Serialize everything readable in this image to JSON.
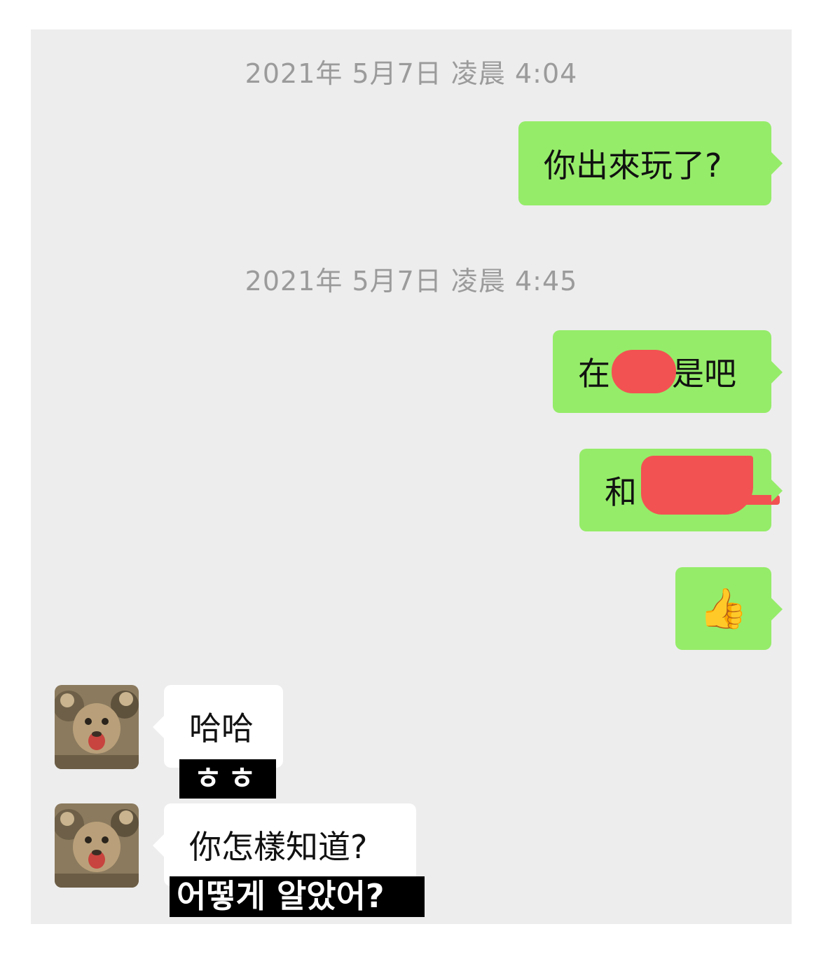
{
  "conversation": {
    "timestamps": [
      "2021年 5月7日 凌晨 4:04",
      "2021年 5月7日 凌晨 4:45"
    ],
    "sent": {
      "msg1": "你出來玩了?",
      "msg2_prefix": "在",
      "msg2_suffix": "是吧",
      "msg3_prefix": "和",
      "msg4_emoji": "👍"
    },
    "received": {
      "msg1": "哈哈",
      "msg1_subtitle": "ㅎㅎ",
      "msg2": "你怎樣知道?",
      "msg2_subtitle": "어떻게 알았어?"
    }
  },
  "colors": {
    "chat_background": "#ededed",
    "sent_bubble": "#95ec69",
    "received_bubble": "#ffffff",
    "redaction": "#f25252",
    "timestamp_text": "#9b9b9b"
  },
  "icons": {
    "avatar": "lion-cub-avatar",
    "thumbs_up": "thumbs-up-emoji"
  }
}
